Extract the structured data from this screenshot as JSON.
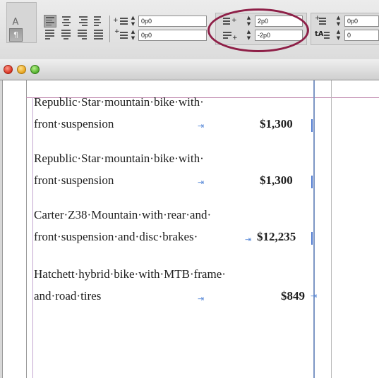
{
  "control_panel": {
    "char_mode_label": "A",
    "para_mode_label": "¶",
    "left_indent": "0p0",
    "first_line_left_indent": "0p0",
    "right_indent": "2p0",
    "last_line_right_indent": "-2p0",
    "space_before": "0p0",
    "drop_cap_lines": "0"
  },
  "window": {
    "close_icon": "close-icon",
    "minimize_icon": "minimize-icon",
    "zoom_icon": "zoom-icon"
  },
  "document": {
    "entries": [
      {
        "line1": "Republic·Star·mountain·bike·with·",
        "line2": "front·suspension",
        "price": "$1,300"
      },
      {
        "line1": "Republic·Star·mountain·bike·with·",
        "line2": "front·suspension",
        "price": "$1,300"
      },
      {
        "line1": "Carter·Z38·Mountain·with·rear·and·",
        "line2": "front·suspension·and·disc·brakes·",
        "price": "$12,235"
      },
      {
        "line1": "Hatchett·hybrid·bike·with·MTB·frame·",
        "line2": "and·road·tires",
        "price": "$849"
      }
    ]
  },
  "colors": {
    "highlight_ellipse": "#8e1f47",
    "guide_blue": "#7d96c4"
  }
}
